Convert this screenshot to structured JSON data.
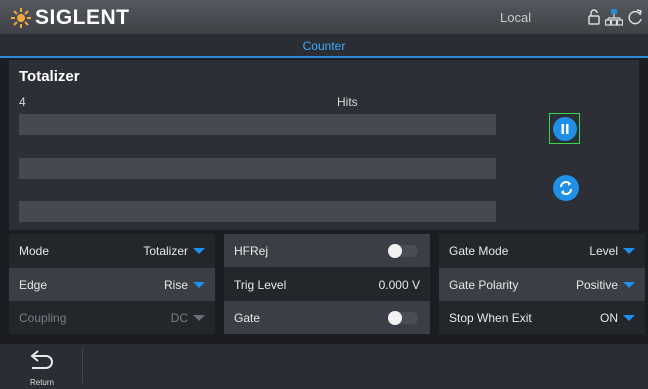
{
  "header": {
    "brand": "SIGLENT",
    "status": "Local",
    "icons": [
      "lock-icon",
      "network-icon",
      "refresh-icon"
    ]
  },
  "tab": {
    "title": "Counter"
  },
  "totalizer": {
    "title": "Totalizer",
    "count": "4",
    "unit": "Hits"
  },
  "settings": {
    "col1": [
      {
        "label": "Mode",
        "value": "Totalizer",
        "enabled": true
      },
      {
        "label": "Edge",
        "value": "Rise",
        "enabled": true
      },
      {
        "label": "Coupling",
        "value": "DC",
        "enabled": false
      }
    ],
    "col2": [
      {
        "label": "HFRej",
        "state": "off"
      },
      {
        "label": "Trig Level",
        "value": "0.000 V"
      },
      {
        "label": "Gate",
        "state": "off"
      }
    ],
    "col3": [
      {
        "label": "Gate Mode",
        "value": "Level"
      },
      {
        "label": "Gate Polarity",
        "value": "Positive"
      },
      {
        "label": "Stop When Exit",
        "value": "ON"
      }
    ]
  },
  "footer": {
    "return_label": "Return"
  },
  "colors": {
    "accent": "#1f8fe8",
    "selected_border": "#38d64b",
    "background": "#1b1d22"
  }
}
